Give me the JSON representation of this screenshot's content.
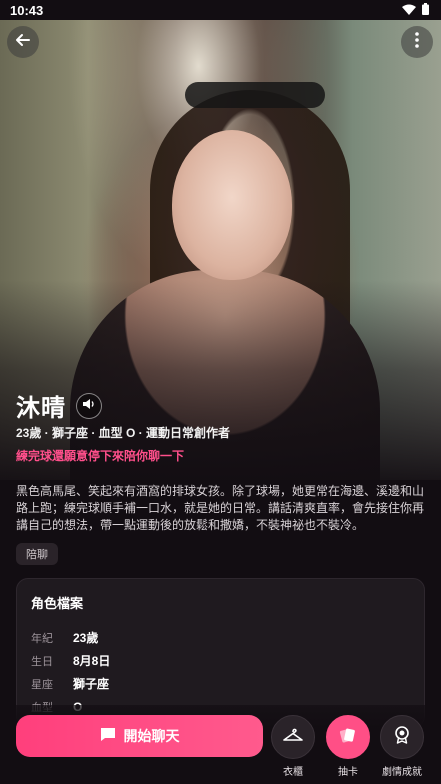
{
  "status_bar": {
    "time": "10:43"
  },
  "character": {
    "name": "沐晴",
    "meta": "23歲 · 獅子座 · 血型 O · 運動日常創作者",
    "tagline": "練完球還願意停下來陪你聊一下",
    "description": "黑色高馬尾、笑起來有酒窩的排球女孩。除了球場，她更常在海邊、溪邊和山路上跑；練完球順手補一口水，就是她的日常。講話清爽直率，會先接住你再講自己的想法，帶一點運動後的放鬆和撒嬌，不裝神祕也不裝冷。",
    "tag": "陪聊"
  },
  "profile": {
    "title": "角色檔案",
    "rows": [
      {
        "key": "年紀",
        "value": "23歲"
      },
      {
        "key": "生日",
        "value": "8月8日"
      },
      {
        "key": "星座",
        "value": "獅子座"
      },
      {
        "key": "血型",
        "value": "O"
      }
    ]
  },
  "actions": {
    "start_chat": "開始聊天",
    "wardrobe": "衣櫃",
    "draw_card": "抽卡",
    "achievements": "劇情成就"
  },
  "colors": {
    "accent": "#ff4f86",
    "tagline": "#ff4f8b",
    "background": "#120d12"
  },
  "icons": [
    "back-arrow-icon",
    "more-vertical-icon",
    "speaker-icon",
    "chat-bubble-icon",
    "hanger-icon",
    "cards-icon",
    "badge-icon",
    "wifi-icon",
    "battery-icon"
  ]
}
